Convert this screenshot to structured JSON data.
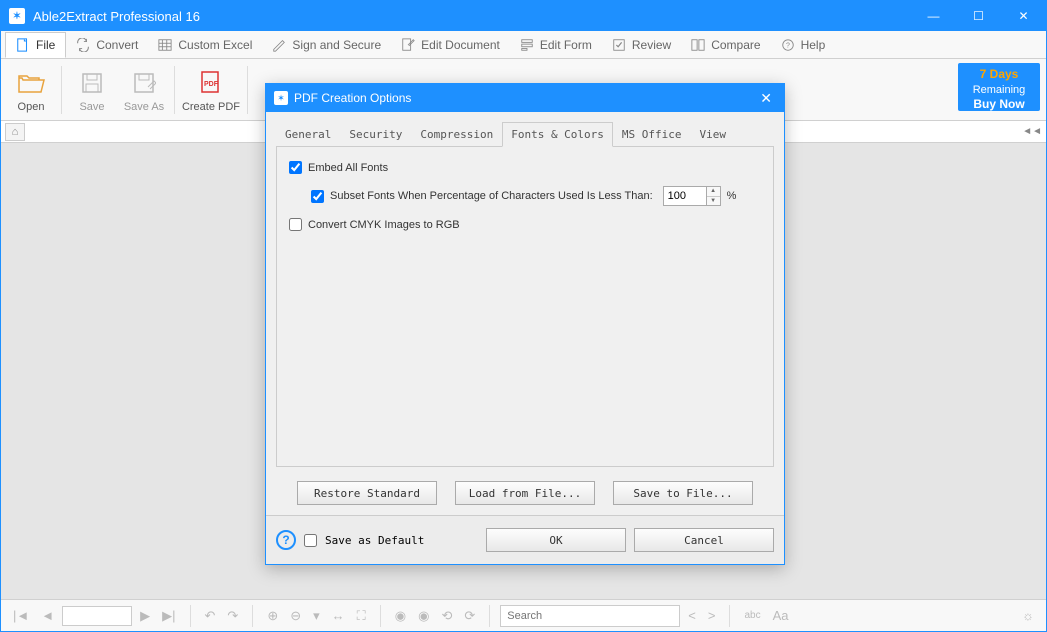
{
  "app": {
    "title": "Able2Extract Professional 16"
  },
  "window_controls": {
    "min": "—",
    "max": "☐",
    "close": "✕"
  },
  "menu": {
    "items": [
      {
        "label": "File"
      },
      {
        "label": "Convert"
      },
      {
        "label": "Custom Excel"
      },
      {
        "label": "Sign and Secure"
      },
      {
        "label": "Edit Document"
      },
      {
        "label": "Edit Form"
      },
      {
        "label": "Review"
      },
      {
        "label": "Compare"
      },
      {
        "label": "Help"
      }
    ]
  },
  "toolbar": {
    "open": "Open",
    "save": "Save",
    "save_as": "Save As",
    "create_pdf": "Create PDF"
  },
  "trial": {
    "days": "7 Days",
    "remaining": "Remaining",
    "buy_now": "Buy Now"
  },
  "dialog": {
    "title": "PDF Creation Options",
    "tabs": [
      "General",
      "Security",
      "Compression",
      "Fonts & Colors",
      "MS Office",
      "View"
    ],
    "active_tab_index": 3,
    "fonts_colors": {
      "embed_all": {
        "label": "Embed All Fonts",
        "checked": true
      },
      "subset": {
        "label": "Subset Fonts When Percentage of Characters Used Is Less Than:",
        "checked": true,
        "value": "100",
        "suffix": "%"
      },
      "cmyk": {
        "label": "Convert CMYK Images to RGB",
        "checked": false
      }
    },
    "buttons": {
      "restore": "Restore Standard",
      "load": "Load from File...",
      "save": "Save to File..."
    },
    "footer": {
      "save_default": {
        "label": "Save as Default",
        "checked": false
      },
      "ok": "OK",
      "cancel": "Cancel"
    }
  },
  "statusbar": {
    "search_placeholder": "Search"
  }
}
